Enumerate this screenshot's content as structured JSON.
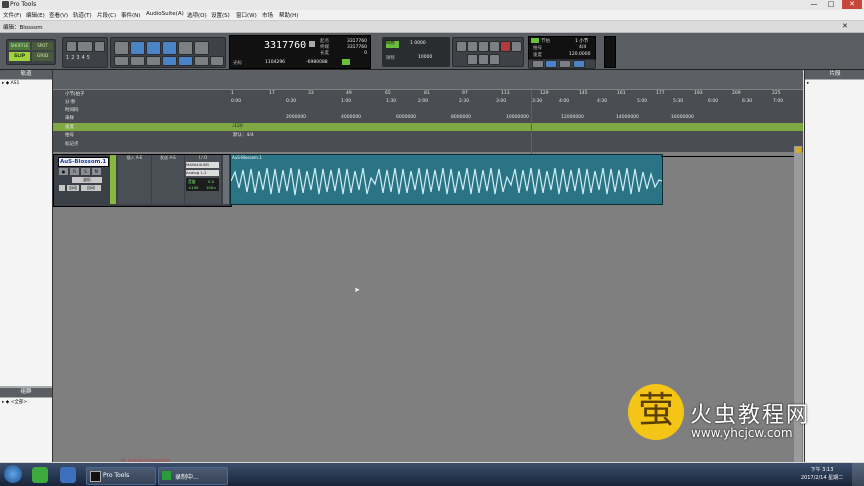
{
  "window": {
    "title": "Pro Tools",
    "controls": [
      "—",
      "□",
      "✕"
    ]
  },
  "menu": [
    "文件(F)",
    "编辑(E)",
    "查看(V)",
    "轨道(T)",
    "片段(C)",
    "事件(N)",
    "AudioSuite(A)",
    "选项(O)",
    "设置(S)",
    "窗口(W)",
    "市场",
    "帮助(H)"
  ],
  "edit_window": {
    "title": "编辑：Blossom"
  },
  "toolbar": {
    "modes": [
      "SHUFFLE",
      "SPOT",
      "SLIP",
      "GRID"
    ],
    "grid_numbers": [
      "1",
      "2",
      "3",
      "4",
      "5"
    ],
    "main_counter": "3317760",
    "counter_labels": [
      "起点",
      "终端",
      "长度"
    ],
    "counter_values": [
      "3317760",
      "3317760",
      "0"
    ],
    "nudge_label": "光标",
    "nudge_value": "1104296",
    "cursor_value": "-6980088",
    "grid_label": "网格",
    "grid_value": "1 0000",
    "nudge_setting_label": "微移",
    "nudge_setting_value": "10000",
    "tempo": {
      "label": "节拍",
      "meter_label": "拍号",
      "meter": "4/4",
      "tempo_label": "速度",
      "tempo_value": "120.0000",
      "bar": "1 小节"
    }
  },
  "left_panel": {
    "title": "轨道",
    "track_label": "AS1",
    "groups_title": "组群",
    "groups_item": "<全部>"
  },
  "right_panel": {
    "title": "片段"
  },
  "ruler_labels": [
    "小节|拍子",
    "分:秒",
    "时间码",
    "采样",
    "速度",
    "拍号",
    "标记点"
  ],
  "bar_ticks": [
    "1",
    "17",
    "33",
    "49",
    "65",
    "81",
    "97",
    "113",
    "129",
    "145",
    "161",
    "177",
    "193",
    "209",
    "225"
  ],
  "min_ticks": [
    "0:00",
    "0:30",
    "1:00",
    "1:30",
    "2:00",
    "2:30",
    "3:00",
    "3:30",
    "4:00",
    "4:30",
    "5:00",
    "5:30",
    "6:00",
    "6:30",
    "7:00"
  ],
  "sample_ticks": [
    "2000000",
    "4000000",
    "6000000",
    "8000000",
    "10000000",
    "12000000",
    "14000000",
    "16000000"
  ],
  "tempo_marker": "♩120",
  "meter_marker": "默认：4/4",
  "track": {
    "name": "AuS-Blossom.1",
    "inserts_label": "插入 A-E",
    "sends_label": "发送 A-E",
    "io_label": "I / O",
    "buttons": [
      "R",
      "S",
      "M"
    ],
    "view": "波形",
    "auto_label": "自动",
    "input": "MAYA44USB",
    "output": "Analog 1-2",
    "vol_label": "音量",
    "vol_value": "0.0",
    "pan_values": [
      "<100",
      "100>"
    ],
    "clip_name": "AuS-Blossom.1"
  },
  "status": {
    "connection": "No Selection Connection"
  },
  "watermark": {
    "char": "萤",
    "cn": "火虫教程网",
    "url": "www.yhcjcw.com"
  },
  "taskbar": {
    "items": [
      "Pro Tools",
      "录制中..."
    ],
    "time": "下午 3:13",
    "date": "2017/2/14 星期二"
  }
}
